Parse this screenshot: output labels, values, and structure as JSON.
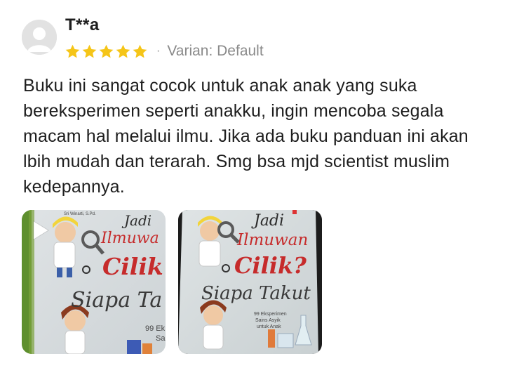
{
  "review": {
    "username": "T**a",
    "rating": 5,
    "rating_max": 5,
    "star_color": "#F5C518",
    "separator": "·",
    "variant": "Varian: Default",
    "text": "Buku ini sangat cocok untuk anak anak yang suka bereksperimen seperti anakku, ingin mencoba segala macam hal melalui ilmu. Jika ada buku panduan ini akan lbih mudah dan terarah. Smg bsa mjd scientist muslim kedepannya."
  },
  "media": {
    "video": {
      "icon": "play-icon",
      "author_text": "Sri Winarti, S.Pd.",
      "title_line1": "Jadi",
      "title_line2": "Ilmuwa",
      "title_line3": "Cilik",
      "title_line4": "Siapa Ta",
      "subtitle_line1": "99 Ek",
      "subtitle_line2": "Sa"
    },
    "photo": {
      "title_line1": "Jadi",
      "title_line2": "Ilmuwan",
      "title_line3": "Cilik?",
      "title_line4": "Siapa Takut",
      "subtitle_line1": "99 Eksperimen",
      "subtitle_line2": "Sains Asyik",
      "subtitle_line3": "untuk Anak"
    }
  }
}
